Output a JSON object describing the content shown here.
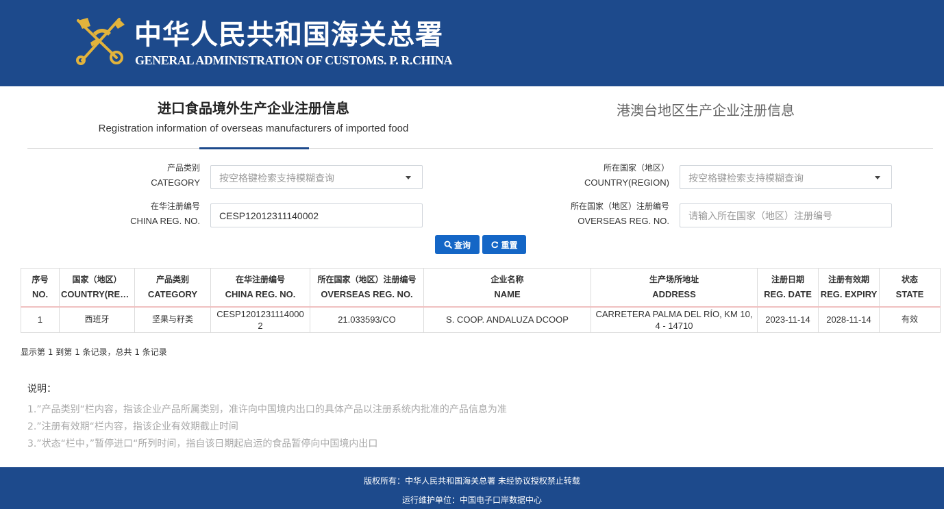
{
  "header": {
    "title_cn": "中华人民共和国海关总署",
    "title_en": "GENERAL ADMINISTRATION OF CUSTOMS. P. R.CHINA"
  },
  "tabs": [
    {
      "label_cn": "进口食品境外生产企业注册信息",
      "label_en": "Registration information of overseas manufacturers of imported food",
      "active": true
    },
    {
      "label_cn": "港澳台地区生产企业注册信息",
      "active": false
    }
  ],
  "form": {
    "category": {
      "label_cn": "产品类别",
      "label_en": "CATEGORY",
      "placeholder": "按空格键检索支持模糊查询"
    },
    "country": {
      "label_cn": "所在国家（地区）",
      "label_en": "COUNTRY(REGION)",
      "placeholder": "按空格键检索支持模糊查询"
    },
    "china_reg": {
      "label_cn": "在华注册编号",
      "label_en": "CHINA REG. NO.",
      "value": "CESP12012311140002"
    },
    "overseas_reg": {
      "label_cn": "所在国家（地区）注册编号",
      "label_en": "OVERSEAS REG. NO.",
      "placeholder": "请输入所在国家（地区）注册编号"
    },
    "search_label": "查询",
    "reset_label": "重置"
  },
  "table": {
    "columns": [
      {
        "cn": "序号",
        "en": "NO."
      },
      {
        "cn": "国家（地区）",
        "en": "COUNTRY(REGION)"
      },
      {
        "cn": "产品类别",
        "en": "CATEGORY"
      },
      {
        "cn": "在华注册编号",
        "en": "CHINA REG. NO."
      },
      {
        "cn": "所在国家（地区）注册编号",
        "en": "OVERSEAS REG. NO."
      },
      {
        "cn": "企业名称",
        "en": "NAME"
      },
      {
        "cn": "生产场所地址",
        "en": "ADDRESS"
      },
      {
        "cn": "注册日期",
        "en": "REG. DATE"
      },
      {
        "cn": "注册有效期",
        "en": "REG. EXPIRY"
      },
      {
        "cn": "状态",
        "en": "STATE"
      }
    ],
    "rows": [
      [
        "1",
        "西班牙",
        "坚果与籽类",
        "CESP12012311140002",
        "21.033593/CO",
        "S. COOP. ANDALUZA DCOOP",
        "CARRETERA PALMA DEL RÍO, KM 10, 4 - 14710",
        "2023-11-14",
        "2028-11-14",
        "有效"
      ]
    ]
  },
  "records_text": "显示第 1 到第 1 条记录，总共 1 条记录",
  "notes": {
    "title": "说明：",
    "lines": [
      "1.”产品类别“栏内容，指该企业产品所属类别，准许向中国境内出口的具体产品以注册系统内批准的产品信息为准",
      "2.”注册有效期“栏内容，指该企业有效期截止时间",
      "3.”状态“栏中，”暂停进口“所列时间，指自该日期起启运的食品暂停向中国境内出口"
    ]
  },
  "footer": {
    "line1": "版权所有：中华人民共和国海关总署 未经协议授权禁止转载",
    "line2": "运行维护单位：中国电子口岸数据中心"
  },
  "icons": {
    "emblem": "customs-emblem-icon",
    "search": "search-icon",
    "reset": "refresh-icon",
    "dropdown": "caret-down-icon"
  },
  "colors": {
    "brand": "#1d4a8c",
    "button": "#1466c6",
    "emblem_gold": "#e2b33c"
  }
}
